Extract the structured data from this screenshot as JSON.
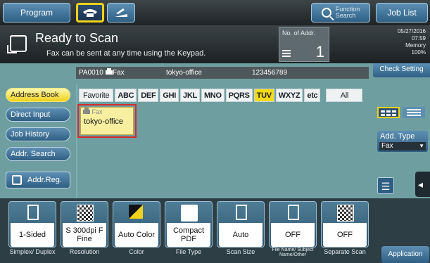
{
  "topbar": {
    "program": "Program",
    "function_search_1": "Function",
    "function_search_2": "Search",
    "job_list": "Job List"
  },
  "status": {
    "title": "Ready to Scan",
    "message": "Fax can be sent at any time using the Keypad.",
    "no_of_addr_label": "No. of Addr.",
    "no_of_addr_value": "1",
    "date": "05/27/2016",
    "time": "07:59",
    "memory_label": "Memory",
    "memory_value": "100%",
    "check_setting": "Check Setting"
  },
  "destination": {
    "id": "PA0010",
    "type": "Fax",
    "name": "tokyo-office",
    "number": "123456789"
  },
  "nav": {
    "address_book": "Address Book",
    "direct_input": "Direct Input",
    "job_history": "Job History",
    "addr_search": "Addr. Search",
    "addr_reg": "Addr.Reg."
  },
  "tabs": [
    "Favorite",
    "ABC",
    "DEF",
    "GHI",
    "JKL",
    "MNO",
    "PQRS",
    "TUV",
    "WXYZ",
    "etc",
    "All"
  ],
  "card": {
    "type": "Fax",
    "name": "tokyo-office"
  },
  "right": {
    "add_type_label": "Add. Type",
    "add_type_value": "Fax"
  },
  "functions": [
    {
      "value": "1-Sided",
      "label": "Simplex/ Duplex"
    },
    {
      "value": "S 300dpi F Fine",
      "label": "Resolution"
    },
    {
      "value": "Auto Color",
      "label": "Color"
    },
    {
      "value": "Compact PDF",
      "label": "File Type"
    },
    {
      "value": "Auto",
      "label": "Scan Size"
    },
    {
      "value": "OFF",
      "label": "File Name/ Subject Name/Other"
    },
    {
      "value": "OFF",
      "label": "Separate Scan"
    }
  ],
  "application": "Application",
  "colors": {
    "accent": "#f1d21a",
    "button": "#2f5e83",
    "background": "#6f9ea0",
    "selected_border": "#d62b2b"
  }
}
